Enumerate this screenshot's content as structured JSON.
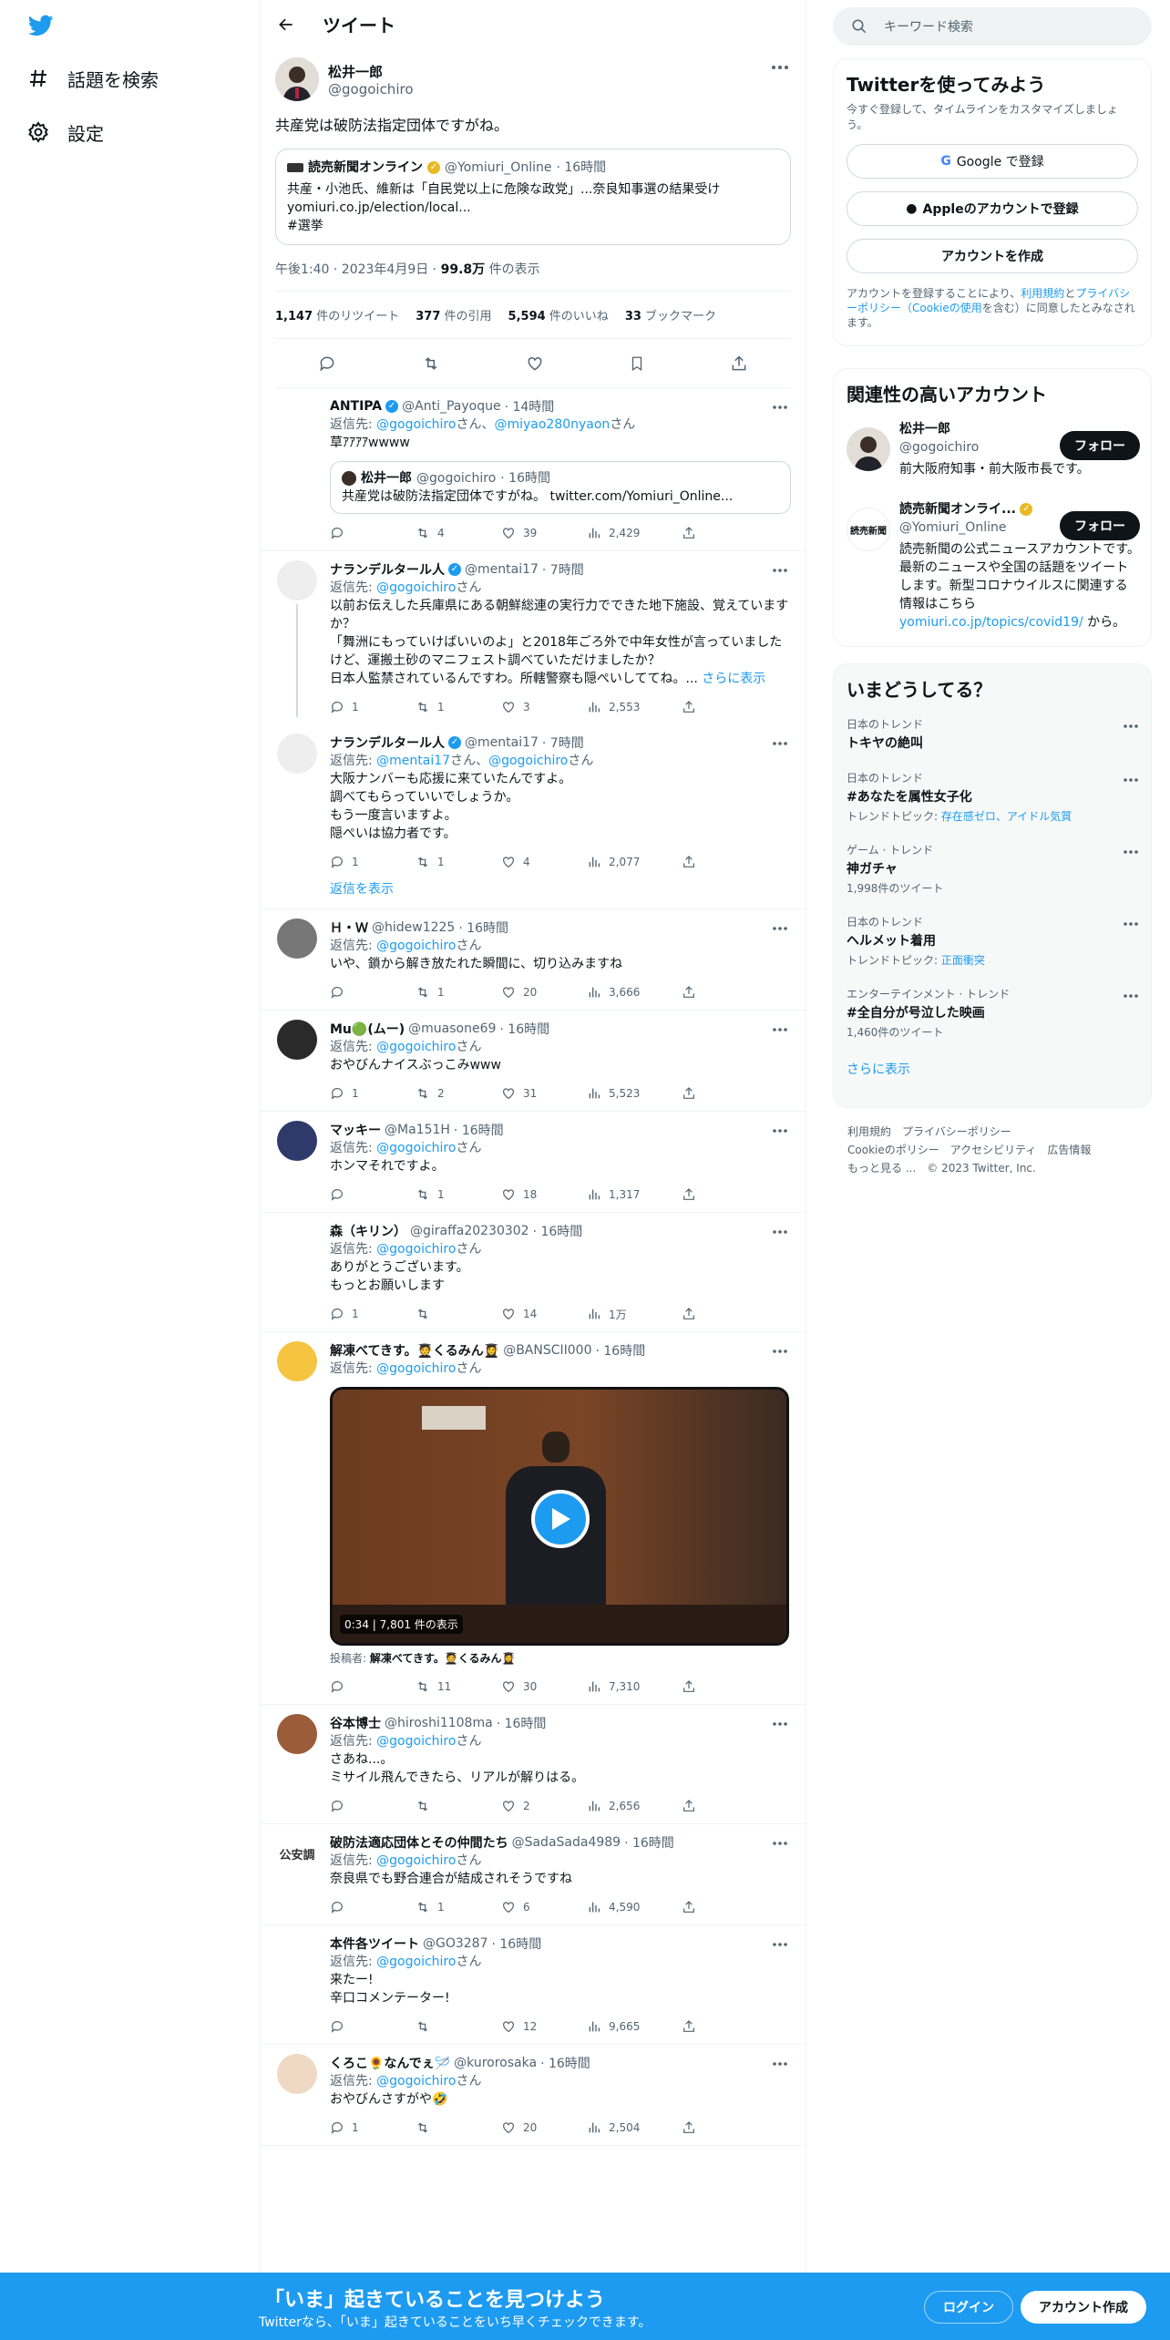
{
  "nav": {
    "explore_label": "話題を検索",
    "settings_label": "設定"
  },
  "header": {
    "title": "ツイート"
  },
  "main_tweet": {
    "name": "松井一郎",
    "handle": "@gogoichiro",
    "text": "共産党は破防法指定団体ですがね。",
    "quote": {
      "name": "読売新聞オンライン",
      "handle": "@Yomiuri_Online",
      "time": "· 16時間",
      "line1": "共産・小池氏、維新は「自民党以上に危険な政党」...奈良知事選の結果受け",
      "line2": "yomiuri.co.jp/election/local...",
      "line3": "#選挙"
    },
    "meta_time": "午後1:40 · 2023年4月9日 · ",
    "meta_views_num": "99.8万",
    "meta_views_label": " 件の表示",
    "retweets_num": "1,147",
    "retweets_label": " 件のリツイート",
    "quotes_num": "377",
    "quotes_label": " 件の引用",
    "likes_num": "5,594",
    "likes_label": " 件のいいね",
    "bookmarks_num": "33",
    "bookmarks_label": " ブックマーク"
  },
  "replies": [
    {
      "name": "ANTIPA",
      "handle": "@Anti_Payoque",
      "time": "· 14時間",
      "to_label": "返信先: ",
      "to1": "@gogoichiro",
      "to_mid": "さん、",
      "to2": "@miyao280nyaon",
      "to_end": "さん",
      "text": "草ｱｱｱｱwwww",
      "inner_name": "松井一郎",
      "inner_handle": "@gogoichiro",
      "inner_time": "· 16時間",
      "inner_text": "共産党は破防法指定団体ですがね。 twitter.com/Yomiuri_Online...",
      "replies": "",
      "retweets": "4",
      "likes": "39",
      "views": "2,429"
    },
    {
      "name": "ナランデルタール人",
      "handle": "@mentai17",
      "time": "· 7時間",
      "to_label": "返信先: ",
      "to1": "@gogoichiro",
      "to_end": "さん",
      "text1": "以前お伝えした兵庫県にある朝鮮総連の実行力でできた地下施設、覚えていますか？",
      "text2": "「舞洲にもっていけばいいのよ」と2018年ごろ外で中年女性が言っていましたけど、運搬土砂のマニフェスト調べていただけましたか？",
      "text3": "日本人監禁されているんですわ。所轄警察も隠ぺいしててね。...",
      "more_link": "さらに表示",
      "replies": "1",
      "retweets": "1",
      "likes": "3",
      "views": "2,553"
    },
    {
      "name": "ナランデルタール人",
      "handle": "@mentai17",
      "time": "· 7時間",
      "to_label": "返信先: ",
      "to1": "@mentai17",
      "to_mid": "さん、",
      "to2": "@gogoichiro",
      "to_end": "さん",
      "text1": "大阪ナンバーも応援に来ていたんですよ。",
      "text2": "調べてもらっていいでしょうか。",
      "text3": "もう一度言いますよ。",
      "text4": "隠ぺいは協力者です。",
      "replies": "1",
      "retweets": "1",
      "likes": "4",
      "views": "2,077",
      "show_replies": "返信を表示"
    },
    {
      "name": "Ｈ・Ｗ",
      "handle": "@hidew1225",
      "time": "· 16時間",
      "to_label": "返信先: ",
      "to1": "@gogoichiro",
      "to_end": "さん",
      "text": "いや、鎖から解き放たれた瞬間に、切り込みますね",
      "replies": "",
      "retweets": "1",
      "likes": "20",
      "views": "3,666"
    },
    {
      "name": "Mu🟢(ムー)",
      "handle": "@muasone69",
      "time": "· 16時間",
      "to_label": "返信先: ",
      "to1": "@gogoichiro",
      "to_end": "さん",
      "text": "おやびんナイスぶっこみwww",
      "replies": "1",
      "retweets": "2",
      "likes": "31",
      "views": "5,523"
    },
    {
      "name": "マッキー",
      "handle": "@Ma151H",
      "time": "· 16時間",
      "to_label": "返信先: ",
      "to1": "@gogoichiro",
      "to_end": "さん",
      "text": "ホンマそれですよ。",
      "replies": "",
      "retweets": "1",
      "likes": "18",
      "views": "1,317"
    },
    {
      "name": "森（キリン）",
      "handle": "@giraffa20230302",
      "time": "· 16時間",
      "to_label": "返信先: ",
      "to1": "@gogoichiro",
      "to_end": "さん",
      "text1": "ありがとうございます。",
      "text2": "もっとお願いします",
      "replies": "1",
      "retweets": "",
      "likes": "14",
      "views": "1万"
    },
    {
      "name": "解凍べてきす。🧑‍🎓くるみん👩‍🎓",
      "handle": "@BANSCII000",
      "time": "· 16時間",
      "to_label": "返信先: ",
      "to1": "@gogoichiro",
      "to_end": "さん",
      "video_tag": "0:34 | 7,801 件の表示",
      "posted_by_label": "投稿者: ",
      "posted_by": "解凍べてきす。🧑‍🎓くるみん👩‍🎓",
      "replies": "",
      "retweets": "11",
      "likes": "30",
      "views": "7,310"
    },
    {
      "name": "谷本博士",
      "handle": "@hiroshi1108ma",
      "time": "· 16時間",
      "to_label": "返信先: ",
      "to1": "@gogoichiro",
      "to_end": "さん",
      "text1": "さあね...。",
      "text2": "ミサイル飛んできたら、リアルが解りはる。",
      "replies": "",
      "retweets": "",
      "likes": "2",
      "views": "2,656"
    },
    {
      "name": "破防法適応団体とその仲間たち",
      "handle": "@SadaSada4989",
      "time": "· 16時間",
      "to_label": "返信先: ",
      "to1": "@gogoichiro",
      "to_end": "さん",
      "text": "奈良県でも野合連合が結成されそうですね",
      "avatar_text": "公安調",
      "replies": "",
      "retweets": "1",
      "likes": "6",
      "views": "4,590"
    },
    {
      "name": "本件各ツイート",
      "handle": "@GO3287",
      "time": "· 16時間",
      "to_label": "返信先: ",
      "to1": "@gogoichiro",
      "to_end": "さん",
      "text1": "来たー!",
      "text2": "辛口コメンテーター!",
      "replies": "",
      "retweets": "",
      "likes": "12",
      "views": "9,665"
    },
    {
      "name": "くろこ🌻なんでぇ🪡",
      "handle": "@kurorosaka",
      "time": "· 16時間",
      "to_label": "返信先: ",
      "to1": "@gogoichiro",
      "to_end": "さん",
      "text": "おやびんさすがや🤣",
      "replies": "1",
      "retweets": "",
      "likes": "20",
      "views": "2,504"
    }
  ],
  "search": {
    "placeholder": "キーワード検索"
  },
  "signup_card": {
    "title": "Twitterを使ってみよう",
    "subtitle": "今すぐ登録して、タイムラインをカスタマイズしましょう。",
    "google_btn": "Google で登録",
    "apple_btn": "Appleのアカウントで登録",
    "create_btn": "アカウントを作成",
    "legal_pre": "アカウントを登録することにより、",
    "legal_terms": "利用規約",
    "legal_and": "と",
    "legal_privacy": "プライバシーポリシー（Cookieの使用",
    "legal_post": "を含む）に同意したとみなされます。"
  },
  "related": {
    "title": "関連性の高いアカウント",
    "accounts": [
      {
        "name": "松井一郎",
        "handle": "@gogoichiro",
        "bio": "前大阪府知事・前大阪市長です。",
        "follow": "フォロー"
      },
      {
        "name": "読売新聞オンライ...",
        "handle": "@Yomiuri_Online",
        "bio": "読売新聞の公式ニュースアカウントです。最新のニュースや全国の話題をツイートします。新型コロナウイルスに関連する情報はこちら",
        "bio_link": "yomiuri.co.jp/topics/covid19/",
        "bio_end": " から。",
        "follow": "フォロー"
      }
    ]
  },
  "trends": {
    "title": "いまどうしてる？",
    "items": [
      {
        "category": "日本のトレンド",
        "name": "トキヤの絶叫",
        "sub": ""
      },
      {
        "category": "日本のトレンド",
        "name": "#あなたを属性女子化",
        "sub_label": "トレンドトピック: ",
        "sub_link": "存在感ゼロ、アイドル気質"
      },
      {
        "category": "ゲーム · トレンド",
        "name": "神ガチャ",
        "sub": "1,998件のツイート"
      },
      {
        "category": "日本のトレンド",
        "name": "ヘルメット着用",
        "sub_label": "トレンドトピック: ",
        "sub_link": "正面衝突"
      },
      {
        "category": "エンターテインメント · トレンド",
        "name": "#全自分が号泣した映画",
        "sub": "1,460件のツイート"
      }
    ],
    "show_more": "さらに表示"
  },
  "footer": {
    "terms": "利用規約",
    "privacy": "プライバシーポリシー",
    "cookie": "Cookieのポリシー",
    "accessibility": "アクセシビリティ",
    "ads": "広告情報",
    "more": "もっと見る ...",
    "copyright": "© 2023 Twitter, Inc."
  },
  "bottombar": {
    "title": "「いま」起きていることを見つけよう",
    "subtitle": "Twitterなら、「いま」起きていることをいち早くチェックできます。",
    "login": "ログイン",
    "signup": "アカウント作成"
  },
  "colors": {
    "accent": "#1d9bf0",
    "text": "#0f1419",
    "muted": "#536471",
    "bottom_bar": "#1d9bf0"
  }
}
